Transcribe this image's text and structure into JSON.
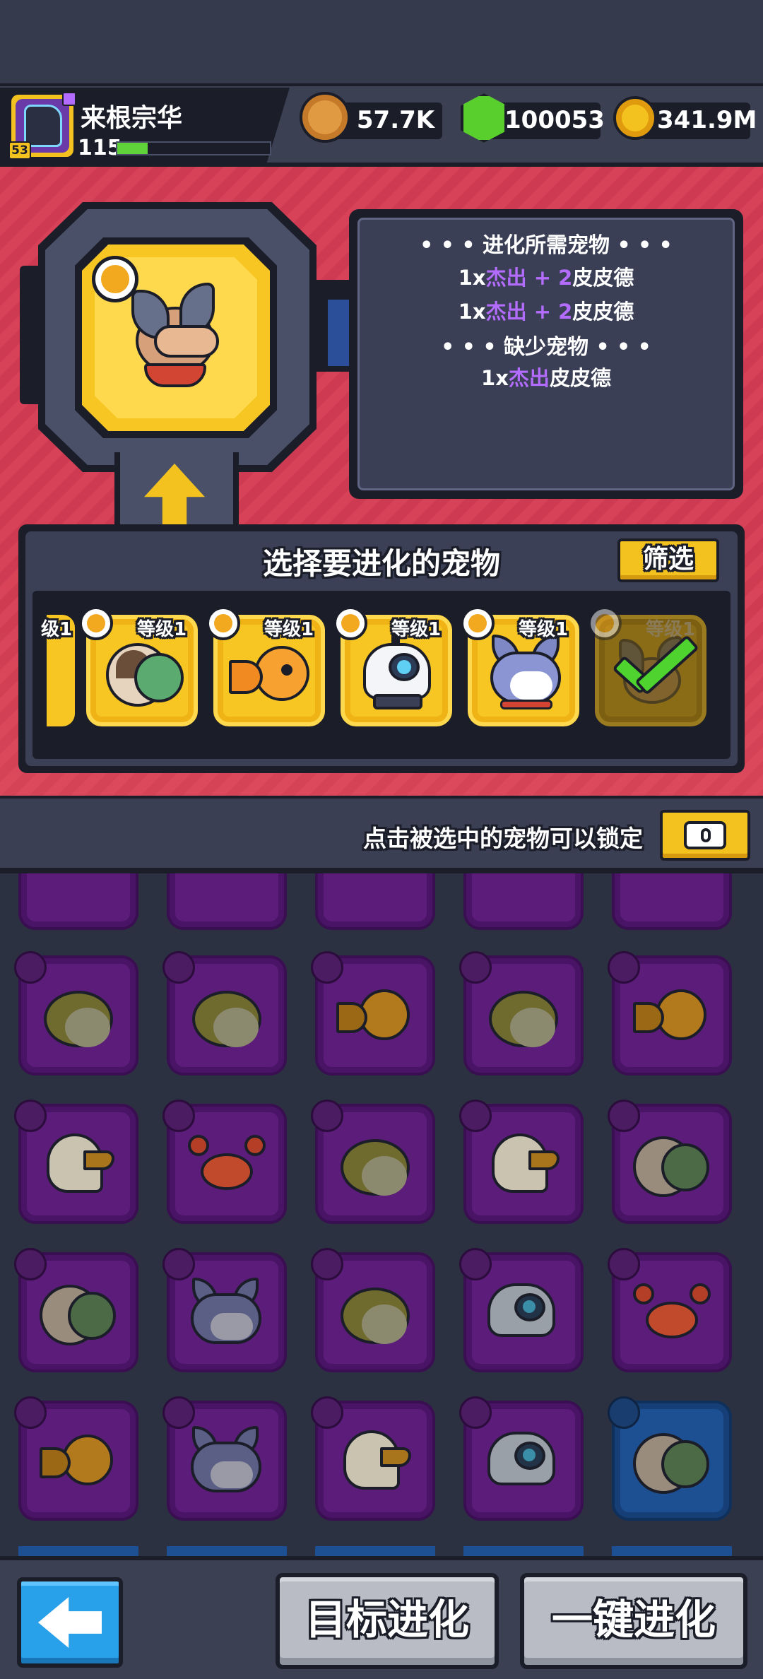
{
  "player": {
    "name": "来根宗华",
    "level": "115",
    "avatar_level": "53",
    "xp_fraction": 0.2
  },
  "currencies": [
    {
      "icon": "lion-coin-icon",
      "value": "57.7K"
    },
    {
      "icon": "green-gem-plus-icon",
      "value": "100053"
    },
    {
      "icon": "gold-coin-plus-icon",
      "value": "341.9M"
    }
  ],
  "target_pet": {
    "icon": "husky-dog-pet-icon"
  },
  "requirements": {
    "header_needed": "• • • 进化所需宠物 • • •",
    "req1": {
      "count": "1x",
      "quality": "杰出",
      "plus": "+ 2",
      "name": "皮皮德"
    },
    "req2": {
      "count": "1x",
      "quality": "杰出",
      "plus": "+ 2",
      "name": "皮皮德"
    },
    "header_missing": "• • • 缺少宠物 • • •",
    "miss1": {
      "count": "1x",
      "quality": "杰出",
      "name": "皮皮德"
    }
  },
  "selection": {
    "title": "选择要进化的宠物",
    "filter_label": "筛选",
    "partial_label": "级1",
    "cards": [
      {
        "level": "等级1",
        "pet": "turtle-pet-icon"
      },
      {
        "level": "等级1",
        "pet": "goldfish-pet-icon"
      },
      {
        "level": "等级1",
        "pet": "robot-pet-icon"
      },
      {
        "level": "等级1",
        "pet": "cat-pet-icon"
      },
      {
        "level": "等级1",
        "pet": "husky-pet-icon",
        "selected": true
      }
    ]
  },
  "lock_hint": "点击被选中的宠物可以锁定",
  "grid_pets": [
    [
      "frog",
      "frog",
      "fish",
      "frog",
      "fish"
    ],
    [
      "eagle",
      "crab",
      "frog",
      "eagle",
      "turtle"
    ],
    [
      "turtle",
      "cat",
      "frog",
      "robot",
      "crab"
    ],
    [
      "fish",
      "cat",
      "eagle",
      "robot",
      "turtle-blue"
    ]
  ],
  "buttons": {
    "target_evolve": "目标进化",
    "one_click_evolve": "一键进化"
  },
  "colors": {
    "gold": "#f7c623",
    "purple_tile": "#5b1c7a",
    "blue_tile": "#1d4f93",
    "quality_purple": "#b46cff",
    "back_button": "#29a0ea"
  }
}
